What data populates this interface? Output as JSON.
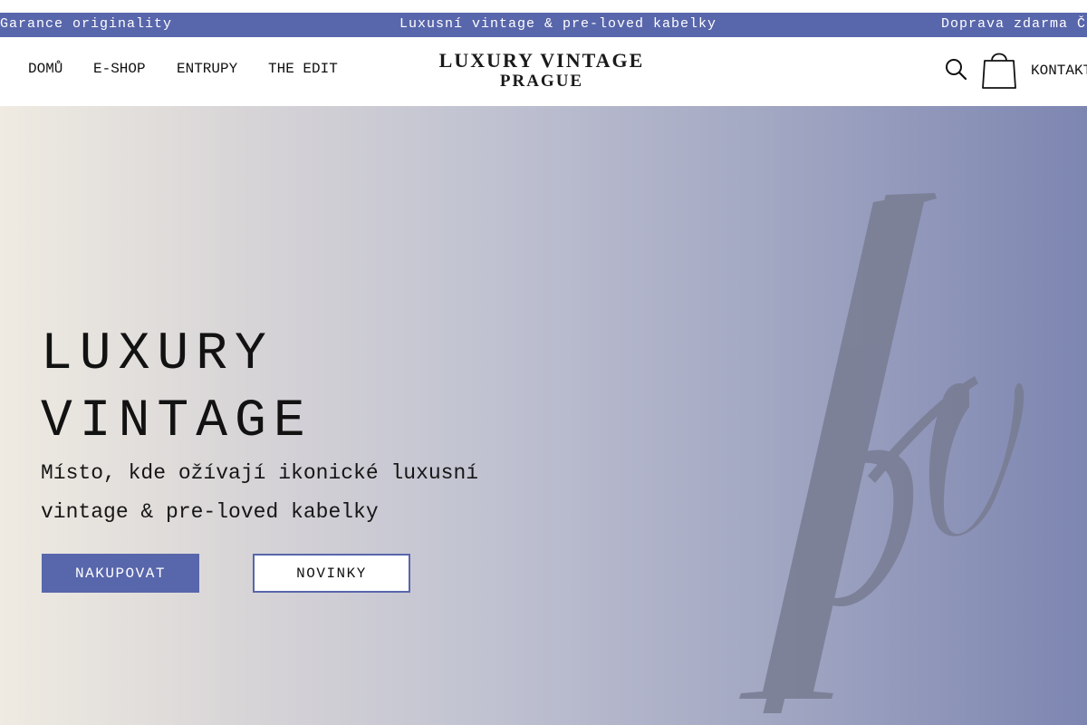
{
  "announcement": {
    "left": "Garance originality",
    "center": "Luxusní vintage & pre-loved kabelky",
    "right": "Doprava zdarma ČR"
  },
  "nav": {
    "items": [
      "DOMŮ",
      "E-SHOP",
      "ENTRUPY",
      "THE EDIT"
    ],
    "contact": "KONTAKT"
  },
  "logo": {
    "line1": "LUXURY VINTAGE",
    "line2": "PRAGUE"
  },
  "icons": {
    "search": "search-icon",
    "cart": "shopping-bag-icon"
  },
  "hero": {
    "title_line1": "LUXURY",
    "title_line2": "VINTAGE",
    "subtitle": "Místo, kde ožívají ikonické luxusní vintage & pre-loved kabelky",
    "primary_button": "NAKUPOVAT",
    "secondary_button": "NOVINKY",
    "monogram": "lv"
  },
  "colors": {
    "accent": "#5866ab",
    "hero_gradient_start": "#efebe2",
    "hero_gradient_end": "#7d86b1",
    "monogram": "#787c92"
  }
}
